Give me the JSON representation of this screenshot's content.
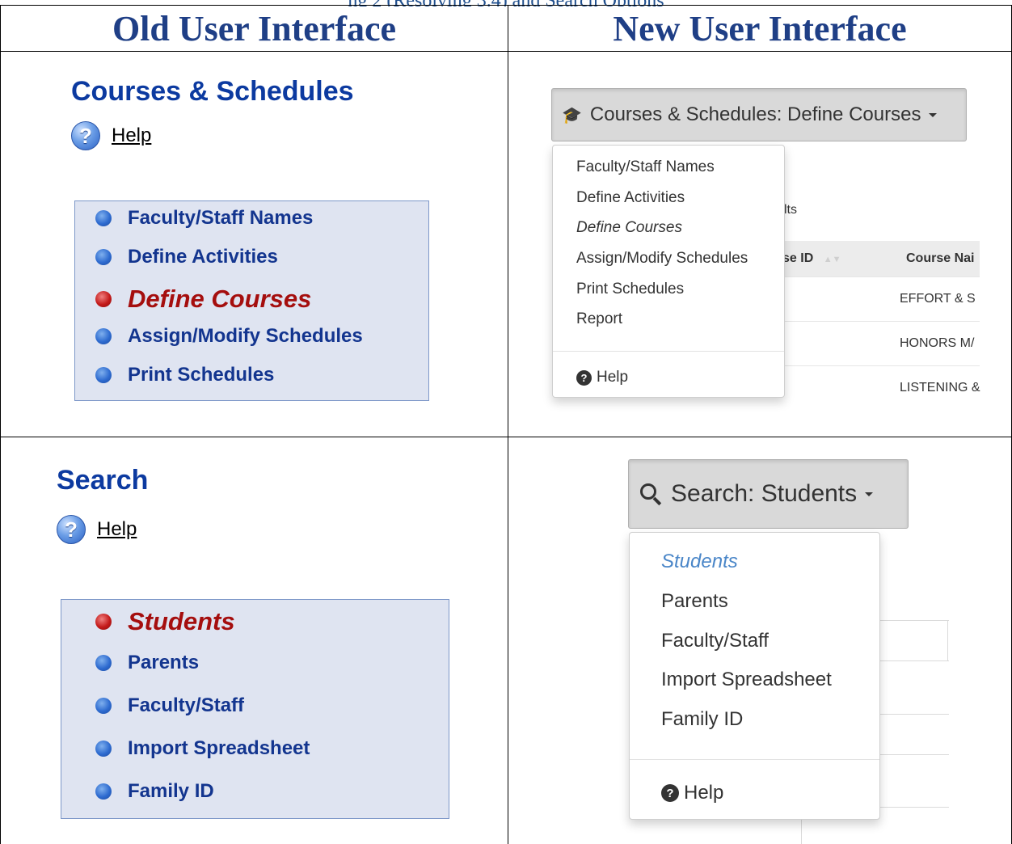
{
  "caption": "ng 2 (Resolving 3.4) and Search Options",
  "headers": {
    "old": "Old User Interface",
    "new": "New User Interface"
  },
  "courses": {
    "old": {
      "title": "Courses & Schedules",
      "help": "Help",
      "items": [
        {
          "label": "Faculty/Staff Names",
          "selected": false
        },
        {
          "label": "Define Activities",
          "selected": false
        },
        {
          "label": "Define Courses",
          "selected": true
        },
        {
          "label": "Assign/Modify Schedules",
          "selected": false
        },
        {
          "label": "Print Schedules",
          "selected": false
        }
      ]
    },
    "new": {
      "button": "Courses & Schedules: Define Courses",
      "button_icon": "graduation-cap-icon",
      "menu": [
        "Faculty/Staff Names",
        "Define Activities",
        "Define Courses",
        "Assign/Modify Schedules",
        "Print Schedules",
        "Report"
      ],
      "active_item": "Define Courses",
      "help": "Help",
      "background": {
        "results_fragment": "lts",
        "col_course_id": "se ID",
        "col_course_name": "Course Nai",
        "rows": [
          "EFFORT & S",
          "HONORS M/",
          "LISTENING &"
        ]
      }
    }
  },
  "search": {
    "old": {
      "title": "Search",
      "help": "Help",
      "items": [
        {
          "label": "Students",
          "selected": true
        },
        {
          "label": "Parents",
          "selected": false
        },
        {
          "label": "Faculty/Staff",
          "selected": false
        },
        {
          "label": "Import Spreadsheet",
          "selected": false
        },
        {
          "label": "Family ID",
          "selected": false
        }
      ]
    },
    "new": {
      "button": "Search: Students",
      "button_icon": "search-icon",
      "menu": [
        "Students",
        "Parents",
        "Faculty/Staff",
        "Import Spreadsheet",
        "Family ID"
      ],
      "active_item": "Students",
      "help": "Help"
    }
  },
  "colors": {
    "old_title": "#0c3aa0",
    "old_selected": "#a50e0e",
    "new_active": "#4a86c8"
  }
}
